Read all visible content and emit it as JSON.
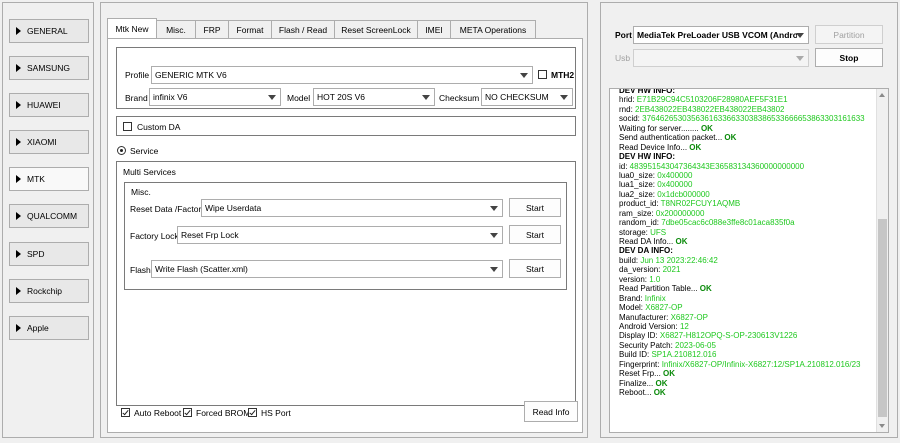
{
  "sidebar": {
    "items": [
      {
        "label": "GENERAL"
      },
      {
        "label": "SAMSUNG"
      },
      {
        "label": "HUAWEI"
      },
      {
        "label": "XIAOMI"
      },
      {
        "label": "MTK"
      },
      {
        "label": "QUALCOMM"
      },
      {
        "label": "SPD"
      },
      {
        "label": "Rockchip"
      },
      {
        "label": "Apple"
      }
    ]
  },
  "tabs": [
    "Mtk New",
    "Misc.",
    "FRP",
    "Format",
    "Flash / Read",
    "Reset ScreenLock",
    "IMEI",
    "META Operations"
  ],
  "main": {
    "profile_label": "Profile",
    "profile_value": "GENERIC MTK V6",
    "mth2_label": "MTH2",
    "brand_label": "Brand",
    "brand_value": "infinix V6",
    "model_label": "Model",
    "model_value": "HOT 20S  V6",
    "checksum_label": "Checksum",
    "checksum_value": "NO CHECKSUM",
    "custom_da_label": "Custom DA",
    "service_label": "Service",
    "multi_services_label": "Multi Services",
    "misc_label": "Misc.",
    "reset_data_label": "Reset Data /Factory",
    "reset_data_value": "Wipe Userdata",
    "factory_lock_label": "Factory Lock",
    "factory_lock_value": "Reset Frp Lock",
    "flash_label": "Flash",
    "flash_value": "Write Flash (Scatter.xml)",
    "start_label": "Start",
    "auto_reboot_label": "Auto Reboot",
    "forced_brom_label": "Forced BROM",
    "hs_port_label": "HS Port",
    "read_info_label": "Read Info"
  },
  "right": {
    "port_label": "Port",
    "port_value": "MediaTek PreLoader USB VCOM (Android) (",
    "partition_label": "Partition",
    "usb_label": "Usb",
    "usb_value": "",
    "stop_label": "Stop"
  },
  "log": [
    {
      "k": "DEV HW INFO:",
      "v": "",
      "cls": "hdr"
    },
    {
      "k": "hrid: ",
      "v": "E71B29C94C5103206F28980AEF5F31E1"
    },
    {
      "k": "rnd: ",
      "v": "2EB438022EB438022EB438022EB43802"
    },
    {
      "k": "socid: ",
      "v": "37646265303563616336633038386533666653863303161633"
    },
    {
      "k": "Waiting for server........ ",
      "ok": "OK"
    },
    {
      "k": "Send authentication packet... ",
      "ok": "OK"
    },
    {
      "k": "Read Device Info... ",
      "ok": "OK"
    },
    {
      "k": "DEV HW INFO:",
      "v": "",
      "cls": "hdr"
    },
    {
      "k": "id: ",
      "v": "483951543047364343E36583134360000000000"
    },
    {
      "k": "lua0_size: ",
      "v": "0x400000"
    },
    {
      "k": "lua1_size: ",
      "v": "0x400000"
    },
    {
      "k": "lua2_size: ",
      "v": "0x1dcb000000"
    },
    {
      "k": "product_id: ",
      "v": "T8NR02FCUY1AQMB"
    },
    {
      "k": "ram_size: ",
      "v": "0x200000000"
    },
    {
      "k": "random_id: ",
      "v": "7dbe05cac6c088e3ffe8c01aca835f0a"
    },
    {
      "k": "storage: ",
      "v": "UFS"
    },
    {
      "k": "Read DA Info... ",
      "ok": "OK"
    },
    {
      "k": "DEV DA INFO:",
      "v": "",
      "cls": "hdr"
    },
    {
      "k": "build: ",
      "v": "Jun 13 2023:22:46:42"
    },
    {
      "k": "da_version: ",
      "v": "2021"
    },
    {
      "k": "version: ",
      "v": "1.0"
    },
    {
      "k": "Read Partition Table... ",
      "ok": "OK"
    },
    {
      "k": " Brand: ",
      "v": "Infinix"
    },
    {
      "k": " Model: ",
      "v": "X6827-OP"
    },
    {
      "k": " Manufacturer: ",
      "v": "X6827-OP"
    },
    {
      "k": "Android Version: ",
      "v": "12"
    },
    {
      "k": "Display ID: ",
      "v": "X6827-H812OPQ-S-OP-230613V1226"
    },
    {
      "k": "Security Patch: ",
      "v": "2023-06-05"
    },
    {
      "k": "Build ID: ",
      "v": "SP1A.210812.016"
    },
    {
      "k": "Fingerprint: ",
      "v": "Infinix/X6827-OP/Infinix-X6827:12/SP1A.210812.016/23"
    },
    {
      "k": "Reset Frp... ",
      "ok": "OK"
    },
    {
      "k": "Finalize... ",
      "ok": "OK"
    },
    {
      "k": "Reboot... ",
      "ok": "OK"
    }
  ]
}
